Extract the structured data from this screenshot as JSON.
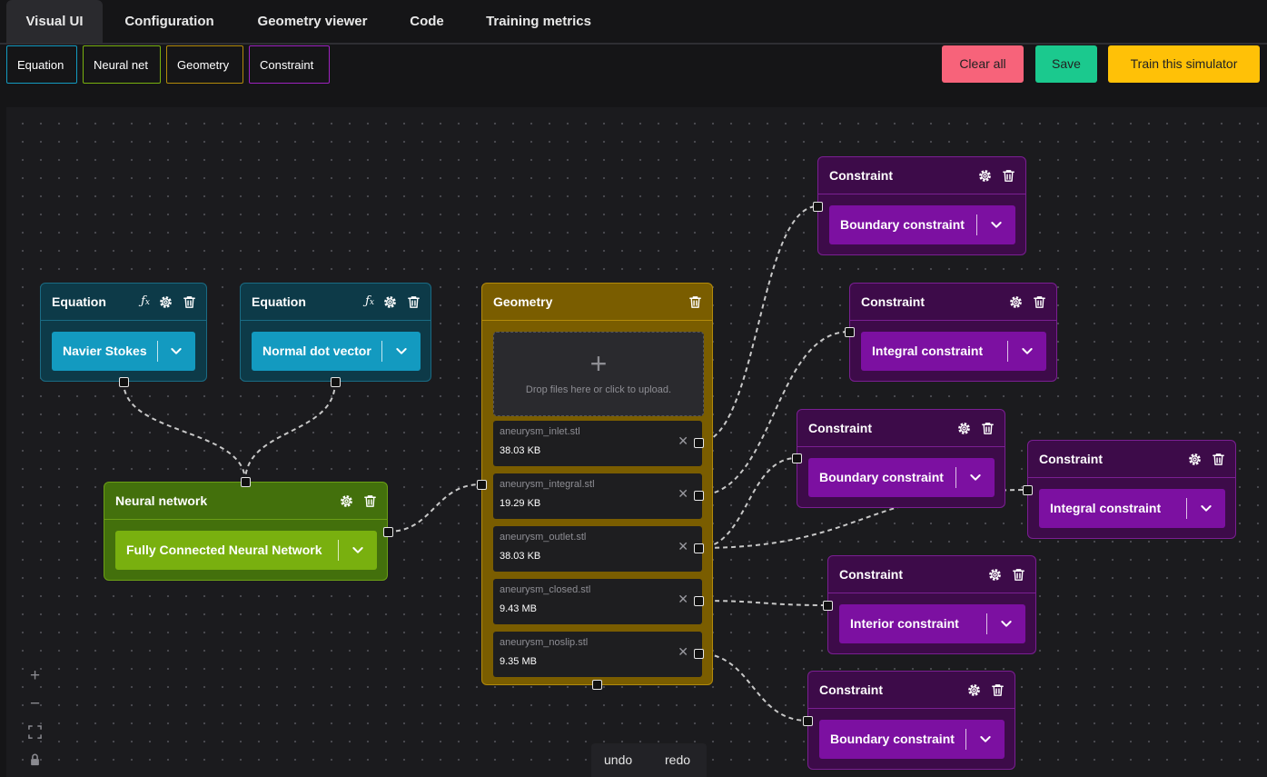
{
  "tabs": [
    "Visual UI",
    "Configuration",
    "Geometry viewer",
    "Code",
    "Training metrics"
  ],
  "palette": [
    "Equation",
    "Neural net",
    "Geometry",
    "Constraint"
  ],
  "actions": {
    "clear": "Clear all",
    "save": "Save",
    "train": "Train this simulator"
  },
  "nodes": {
    "eq1": {
      "title": "Equation",
      "value": "Navier Stokes"
    },
    "eq2": {
      "title": "Equation",
      "value": "Normal dot vector"
    },
    "nn": {
      "title": "Neural network",
      "value": "Fully Connected Neural Network"
    },
    "geo": {
      "title": "Geometry",
      "drop_text": "Drop files here or click to upload.",
      "files": [
        {
          "name": "aneurysm_inlet.stl",
          "size": "38.03 KB"
        },
        {
          "name": "aneurysm_integral.stl",
          "size": "19.29 KB"
        },
        {
          "name": "aneurysm_outlet.stl",
          "size": "38.03 KB"
        },
        {
          "name": "aneurysm_closed.stl",
          "size": "9.43 MB"
        },
        {
          "name": "aneurysm_noslip.stl",
          "size": "9.35 MB"
        }
      ]
    },
    "c1": {
      "title": "Constraint",
      "value": "Boundary constraint"
    },
    "c2": {
      "title": "Constraint",
      "value": "Integral constraint"
    },
    "c3": {
      "title": "Constraint",
      "value": "Boundary constraint"
    },
    "c4": {
      "title": "Constraint",
      "value": "Integral constraint"
    },
    "c5": {
      "title": "Constraint",
      "value": "Interior constraint"
    },
    "c6": {
      "title": "Constraint",
      "value": "Boundary constraint"
    }
  },
  "zoom_controls": [
    "zoom-in",
    "zoom-out",
    "fit-view",
    "lock"
  ],
  "history": {
    "undo": "undo",
    "redo": "redo"
  },
  "colors": {
    "equation": "#139ac0",
    "neural_net": "#79b00f",
    "geometry": "#b38a0a",
    "constraint": "#7c10a1",
    "clear": "#f7637a",
    "save": "#1bc98e",
    "train": "#ffc107"
  }
}
